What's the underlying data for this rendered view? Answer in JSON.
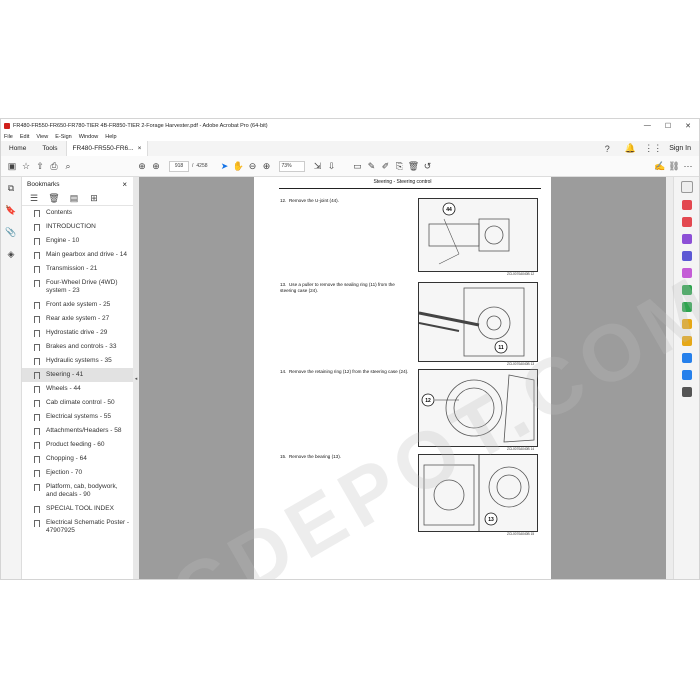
{
  "window": {
    "title": "FR480-FR550-FR650-FR780-TIER 4B-FR850-TIER 2-Forage Harvester.pdf - Adobe Acrobat Pro (64-bit)",
    "controls": [
      "—",
      "☐",
      "✕"
    ]
  },
  "menu": [
    "File",
    "Edit",
    "View",
    "E-Sign",
    "Window",
    "Help"
  ],
  "tabs": {
    "home": "Home",
    "tools": "Tools",
    "doc": "FR480-FR550-FR6...",
    "doc_close": "×",
    "signin": "Sign In"
  },
  "toolbar": {
    "page_current": "918",
    "page_sep": "/",
    "page_total": "4258",
    "zoom": "73%"
  },
  "bookmarks": {
    "title": "Bookmarks",
    "close": "×",
    "items": [
      "Contents",
      "INTRODUCTION",
      "Engine - 10",
      "Main gearbox and drive - 14",
      "Transmission - 21",
      "Four-Wheel Drive (4WD) system - 23",
      "Front axle system - 25",
      "Rear axle system - 27",
      "Hydrostatic drive - 29",
      "Brakes and controls - 33",
      "Hydraulic systems - 35",
      "Steering - 41",
      "Wheels - 44",
      "Cab climate control - 50",
      "Electrical systems - 55",
      "Attachments/Headers - 58",
      "Product feeding - 60",
      "Chopping - 64",
      "Ejection - 70",
      "Platform, cab, bodywork, and decals - 90",
      "SPECIAL TOOL INDEX",
      "Electrical Schematic Poster - 47907925"
    ],
    "selected_index": 11
  },
  "document": {
    "header": "Steering - Steering control",
    "steps": [
      {
        "num": "12.",
        "text": "Remove the U-joint (44).",
        "callouts": [
          "44"
        ],
        "caption": "ZCL0070A040B"
      },
      {
        "num": "13.",
        "text": "Use a puller to remove the sealing ring (11) from the steering case (24).",
        "callouts": [
          "11"
        ],
        "caption": "ZCL0070A040B"
      },
      {
        "num": "14.",
        "text": "Remove the retaining ring (12) from the steering case (24).",
        "callouts": [
          "12"
        ],
        "caption": "ZCL0070A040B"
      },
      {
        "num": "15.",
        "text": "Remove the bearing (13).",
        "callouts": [
          "13"
        ],
        "caption": "ZCL0070A040B"
      }
    ],
    "fig_numbers": [
      "12",
      "13",
      "14",
      "15"
    ]
  },
  "watermark": "PCDEPOT.COM",
  "colors": {
    "accent": "#1473e6",
    "viewer_bg": "#9c9c9c"
  }
}
